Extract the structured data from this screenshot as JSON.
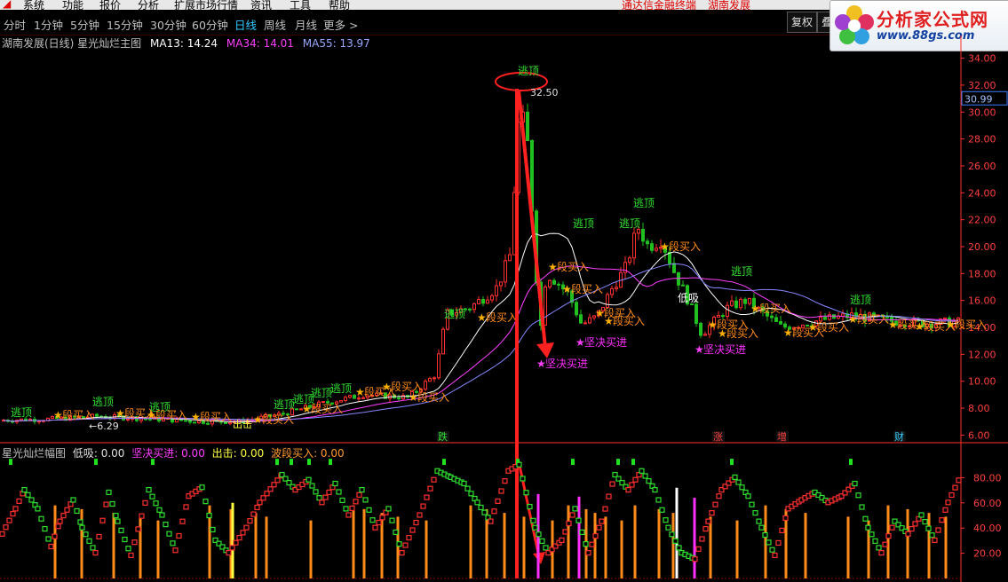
{
  "menubar": {
    "items": [
      "系统",
      "功能",
      "报价",
      "分析",
      "扩展市场行情",
      "资讯",
      "工具",
      "帮助"
    ],
    "right_items": [
      "通达信金融终端",
      "湖南发展"
    ]
  },
  "periods": {
    "items": [
      "分时",
      "1分钟",
      "5分钟",
      "15分钟",
      "30分钟",
      "60分钟",
      "日线",
      "周线",
      "月线",
      "更多 >"
    ],
    "active": "日线"
  },
  "buttons": {
    "restore": "复权",
    "overlay": "叠"
  },
  "logo": {
    "brand": "分析家公式网",
    "url": "www.88gs.com"
  },
  "info": {
    "stock_label": "湖南发展(日线) 星光灿烂主图",
    "ma13": "MA13: 14.24",
    "ma34": "MA34: 14.01",
    "ma55": "MA55: 13.97"
  },
  "indicator_info": {
    "name": "星光灿烂幅图",
    "low": "低吸: 0.00",
    "strong_buy": "坚决买进: 0.00",
    "sell": "出击: 0.00",
    "band_buy": "波段买入: 0.00"
  },
  "colors": {
    "ma13": "#ffffff",
    "ma34": "#ff40ff",
    "ma55": "#8888ff",
    "up": "#ff3030",
    "down": "#20c020",
    "axis": "#ff3030",
    "escape": "#30e030",
    "band_buy": "#ff8c1a",
    "strong_buy": "#ff30ff"
  },
  "price_axis": {
    "ticks": [
      "34.00",
      "32.00",
      "30.00",
      "28.00",
      "26.00",
      "24.00",
      "22.00",
      "20.00",
      "18.00",
      "16.00",
      "14.00",
      "12.00",
      "10.00",
      "8.00",
      "6.00"
    ],
    "current": "30.99"
  },
  "ind_axis": {
    "ticks": [
      "80.00",
      "60.00",
      "40.00",
      "20.00"
    ]
  },
  "markers": {
    "high_price": "32.50",
    "low_price": "6.29",
    "escape_label": "逃顶",
    "band_buy_label": "段买入",
    "strong_buy_label": "坚决买进",
    "low_suck_label": "低吸",
    "sell_label": "出击"
  },
  "events": [
    "跌",
    "涨",
    "增",
    "财"
  ],
  "chart_data": {
    "type": "candlestick",
    "ylim": [
      5.5,
      34.5
    ],
    "ma_values": {
      "MA13": 14.24,
      "MA34": 14.01,
      "MA55": 13.97
    },
    "price_high": 32.5,
    "price_low": 6.29,
    "current_price": 30.99,
    "indicator_ylim": [
      0,
      100
    ]
  }
}
